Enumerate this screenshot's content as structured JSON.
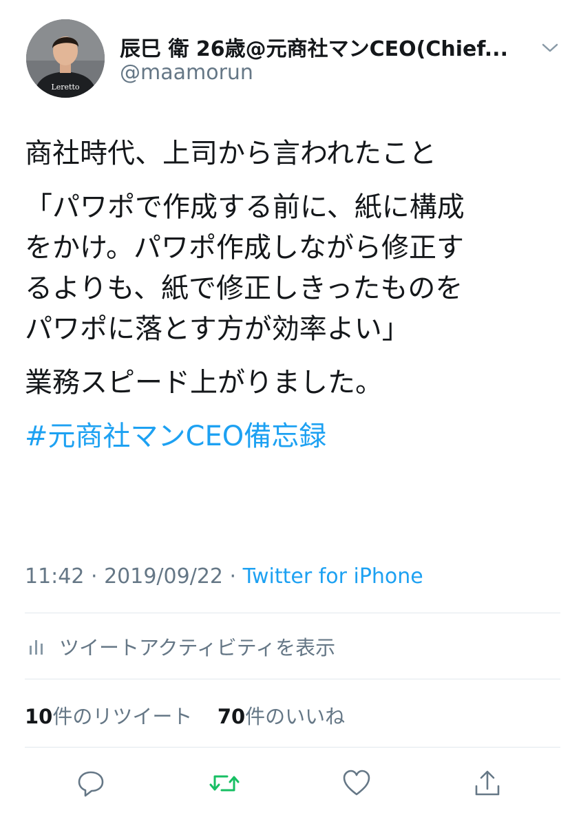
{
  "user": {
    "display_name": "辰巳 衛 26歳@元商社マンCEO(Chief...",
    "handle": "@maamorun",
    "shirt_text": "Leretto"
  },
  "tweet": {
    "line1": "商社時代、上司から言われたこと",
    "quote_lines": [
      "「パワポで作成する前に、紙に構成",
      "をかけ。パワポ作成しながら修正す",
      "るよりも、紙で修正しきったものを",
      "パワポに落とす方が効率よい」"
    ],
    "line_result": "業務スピード上がりました。",
    "hashtag": "#元商社マンCEO備忘録"
  },
  "meta": {
    "time": "11:42",
    "sep1": " · ",
    "date": "2019/09/22",
    "sep2": " · ",
    "source": "Twitter for iPhone"
  },
  "activity_label": "ツイートアクティビティを表示",
  "stats": {
    "retweet_count": "10",
    "retweet_label": "件のリツイート",
    "like_count": "70",
    "like_label": "件のいいね"
  },
  "icons": {
    "reply": "reply-icon",
    "retweet": "retweet-icon",
    "like": "heart-icon",
    "share": "share-icon",
    "menu": "chevron-down-icon",
    "activity": "bar-chart-icon"
  },
  "colors": {
    "link": "#1da1f2",
    "retweet_green": "#17bf63",
    "muted": "#657786",
    "text": "#14171a",
    "divider": "#e1e8ed"
  }
}
